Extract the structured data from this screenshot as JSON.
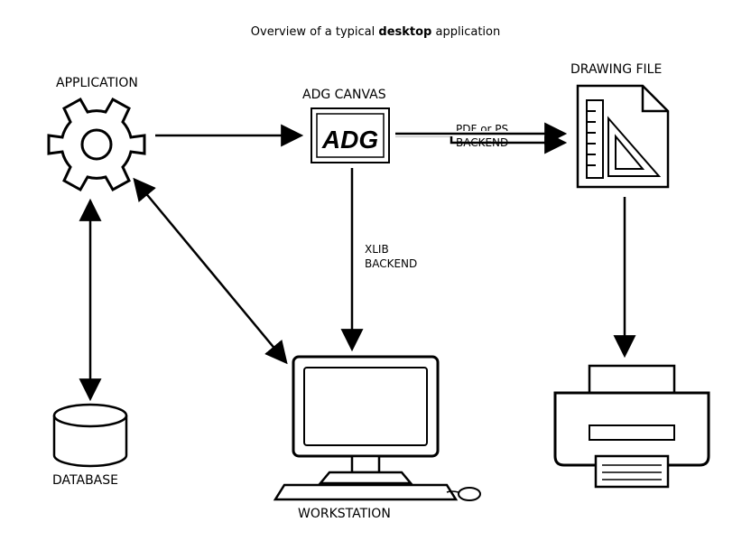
{
  "title": {
    "prefix": "Overview of a typical ",
    "bold": "desktop",
    "suffix": " application"
  },
  "nodes": {
    "application": {
      "label": "APPLICATION"
    },
    "adg_canvas": {
      "label": "ADG CANVAS",
      "logo_text": "ADG"
    },
    "drawing_file": {
      "label": "DRAWING FILE"
    },
    "database": {
      "label": "DATABASE"
    },
    "workstation": {
      "label": "WORKSTATION"
    },
    "printer": {
      "label": ""
    }
  },
  "edges": {
    "app_to_canvas": {
      "label": ""
    },
    "canvas_to_file": {
      "label_line1": "PDF or PS",
      "label_line2": "BACKEND"
    },
    "canvas_to_workstation": {
      "label_line1": "XLIB",
      "label_line2": "BACKEND"
    },
    "app_to_workstation": {
      "label": ""
    },
    "app_to_database": {
      "label": ""
    },
    "file_to_printer": {
      "label": ""
    }
  },
  "style": {
    "stroke": "#000000",
    "fill": "#ffffff"
  }
}
